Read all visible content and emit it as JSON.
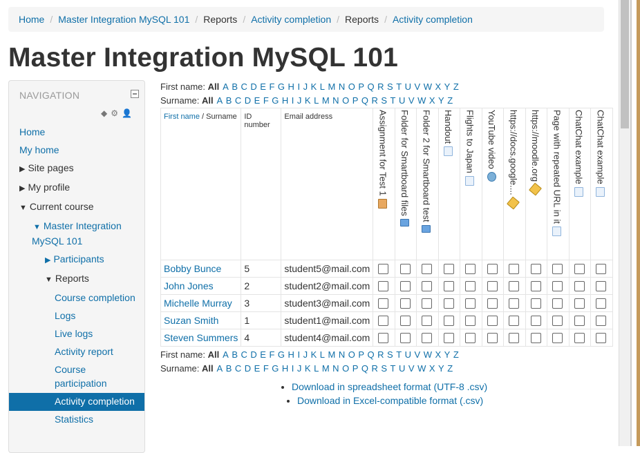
{
  "breadcrumb": {
    "items": [
      "Home",
      "Master Integration MySQL 101",
      "Reports",
      "Activity completion",
      "Reports",
      "Activity completion"
    ]
  },
  "page_title": "Master Integration MySQL 101",
  "navigation": {
    "title": "NAVIGATION",
    "tools": [
      "diamond-icon",
      "gear-icon",
      "add-user-icon"
    ],
    "items": [
      {
        "label": "Home"
      },
      {
        "label": "My home"
      },
      {
        "label": "Site pages"
      },
      {
        "label": "My profile"
      },
      {
        "label": "Current course"
      },
      {
        "label": "Master Integration MySQL 101"
      },
      {
        "label": "Participants"
      },
      {
        "label": "Reports"
      },
      {
        "label": "Course completion"
      },
      {
        "label": "Logs"
      },
      {
        "label": "Live logs"
      },
      {
        "label": "Activity report"
      },
      {
        "label": "Course participation"
      },
      {
        "label": "Activity completion"
      },
      {
        "label": "Statistics"
      }
    ]
  },
  "filters": {
    "first_name_label": "First name:",
    "surname_label": "Surname:",
    "all_label": "All",
    "letters": [
      "A",
      "B",
      "C",
      "D",
      "E",
      "F",
      "G",
      "H",
      "I",
      "J",
      "K",
      "L",
      "M",
      "N",
      "O",
      "P",
      "Q",
      "R",
      "S",
      "T",
      "U",
      "V",
      "W",
      "X",
      "Y",
      "Z"
    ]
  },
  "table": {
    "col_first_name": "First name",
    "col_name_sep": " / Surname",
    "col_id": "ID number",
    "col_email": "Email address",
    "activities": [
      {
        "name": "Assignment for Test 1",
        "icon": "assignment-icon"
      },
      {
        "name": "Folder for Smartboard files",
        "icon": "folder-icon"
      },
      {
        "name": "Folder 2 for Smartboard test",
        "icon": "folder-icon"
      },
      {
        "name": "Handout",
        "icon": "page-icon"
      },
      {
        "name": "Flights to Japan",
        "icon": "page-icon"
      },
      {
        "name": "YouTube video",
        "icon": "video-icon"
      },
      {
        "name": "https://docs.google....",
        "icon": "url-icon"
      },
      {
        "name": "https://moodle.org",
        "icon": "url-icon"
      },
      {
        "name": "Page with repeated URL in it",
        "icon": "page-icon"
      },
      {
        "name": "ChatChat example",
        "icon": "page-icon"
      },
      {
        "name": "ChatChat example",
        "icon": "page-icon"
      }
    ],
    "rows": [
      {
        "name": "Bobby Bunce",
        "id": "5",
        "email": "student5@mail.com"
      },
      {
        "name": "John Jones",
        "id": "2",
        "email": "student2@mail.com"
      },
      {
        "name": "Michelle Murray",
        "id": "3",
        "email": "student3@mail.com"
      },
      {
        "name": "Suzan Smith",
        "id": "1",
        "email": "student1@mail.com"
      },
      {
        "name": "Steven Summers",
        "id": "4",
        "email": "student4@mail.com"
      }
    ]
  },
  "downloads": {
    "csv_utf8": "Download in spreadsheet format (UTF-8 .csv)",
    "csv_excel": "Download in Excel-compatible format (.csv)"
  }
}
